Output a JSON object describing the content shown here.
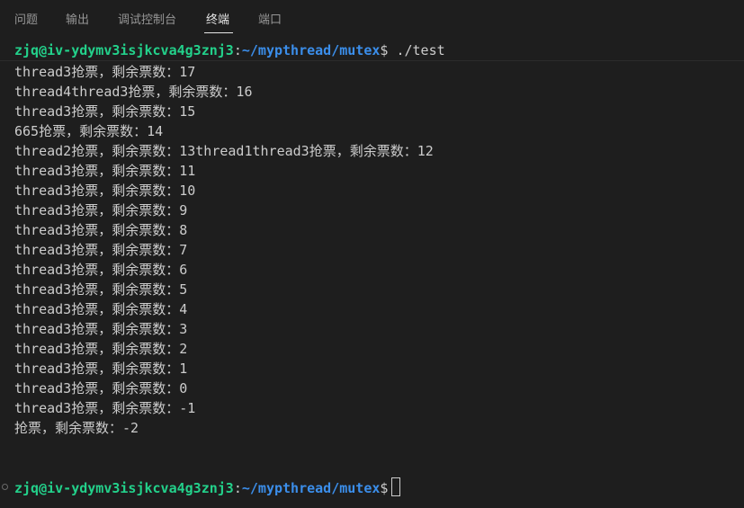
{
  "tabs": [
    {
      "label": "问题"
    },
    {
      "label": "输出"
    },
    {
      "label": "调试控制台"
    },
    {
      "label": "终端",
      "active": true
    },
    {
      "label": "端口"
    }
  ],
  "terminal": {
    "prompt1": {
      "user": "zjq@iv-ydymv3isjkcva4g3znj3",
      "colon": ":",
      "path": "~/mypthread/mutex",
      "dollar": "$",
      "command": " ./test"
    },
    "output_lines": [
      "thread3抢票，剩余票数：17",
      "thread4thread3抢票，剩余票数：16",
      "thread3抢票，剩余票数：15",
      "665抢票，剩余票数：14",
      "thread2抢票，剩余票数：13thread1thread3抢票，剩余票数：12",
      "thread3抢票，剩余票数：11",
      "thread3抢票，剩余票数：10",
      "thread3抢票，剩余票数：9",
      "thread3抢票，剩余票数：8",
      "thread3抢票，剩余票数：7",
      "thread3抢票，剩余票数：6",
      "thread3抢票，剩余票数：5",
      "thread3抢票，剩余票数：4",
      "thread3抢票，剩余票数：3",
      "thread3抢票，剩余票数：2",
      "thread3抢票，剩余票数：1",
      "thread3抢票，剩余票数：0",
      "thread3抢票，剩余票数：-1",
      "抢票，剩余票数：-2"
    ],
    "prompt2": {
      "user": "zjq@iv-ydymv3isjkcva4g3znj3",
      "colon": ":",
      "path": "~/mypthread/mutex",
      "dollar": "$"
    }
  },
  "colors": {
    "background": "#1e1e1e",
    "prompt_user": "#23d18b",
    "prompt_path": "#3b8eea",
    "text": "#cccccc"
  }
}
